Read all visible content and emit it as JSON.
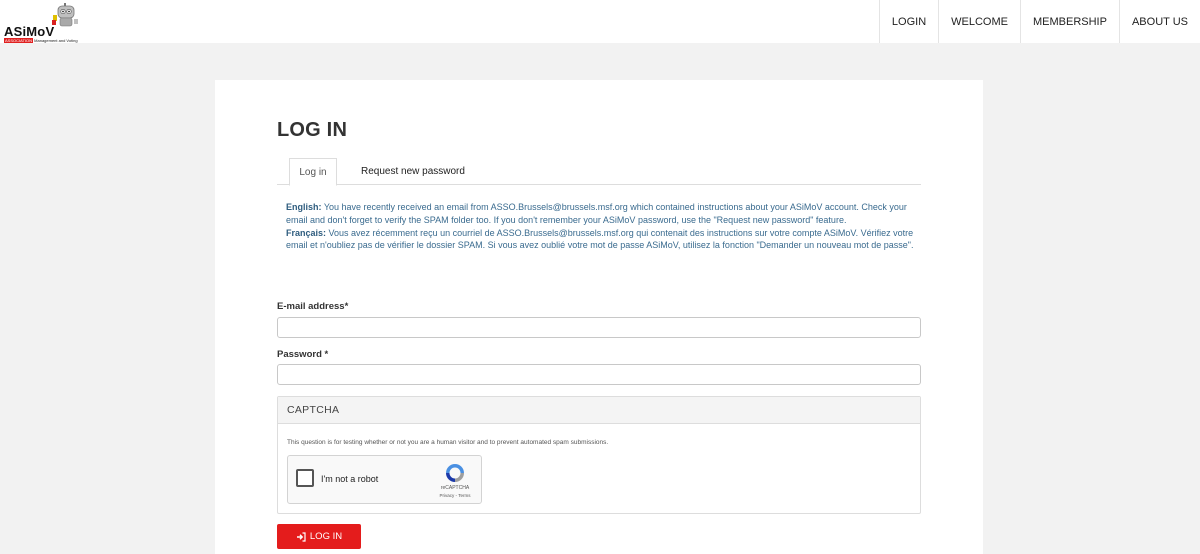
{
  "header": {
    "logo_text": "ASiMoV",
    "logo_tagline_highlight": "ASSOCIATION",
    "logo_tagline_rest": "Management and Voting",
    "nav": [
      "LOGIN",
      "WELCOME",
      "MEMBERSHIP",
      "ABOUT US"
    ]
  },
  "page": {
    "title": "LOG IN",
    "tabs": {
      "active": "Log in",
      "other": "Request new password"
    },
    "info": {
      "en_label": "English:",
      "en_text": " You have recently received an email from ASSO.Brussels@brussels.msf.org which contained instructions about your ASiMoV account. Check your email and don't forget to verify the SPAM folder too. If you don't remember your ASiMoV password, use the \"Request new password\" feature.",
      "fr_label": "Français:",
      "fr_text": " Vous avez récemment reçu un courriel de ASSO.Brussels@brussels.msf.org qui contenait des instructions sur votre compte ASiMoV. Vérifiez votre email et n'oubliez pas de vérifier le dossier SPAM. Si vous avez oublié votre mot de passe ASiMoV, utilisez la fonction \"Demander un nouveau mot de passe\"."
    },
    "form": {
      "email_label": "E-mail address*",
      "email_value": "",
      "password_label": "Password *",
      "password_value": ""
    },
    "captcha": {
      "heading": "CAPTCHA",
      "description": "This question is for testing whether or not you are a human visitor and to prevent automated spam submissions.",
      "checkbox_label": "I'm not a robot",
      "brand": "reCAPTCHA",
      "links": "Privacy - Terms"
    },
    "submit_label": "LOG IN"
  },
  "colors": {
    "accent_red": "#e41c1c",
    "info_text": "#3a6b8f",
    "page_bg": "#f2f2f2"
  },
  "icons": [
    "robot-mascot-icon",
    "sign-in-icon",
    "recaptcha-icon"
  ]
}
